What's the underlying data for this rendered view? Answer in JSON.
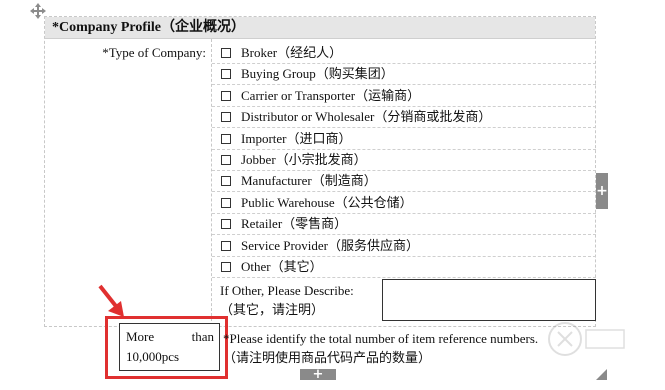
{
  "section": {
    "title": "*Company Profile（企业概况）"
  },
  "type_of_company": {
    "label": "*Type of Company:",
    "options": [
      {
        "label": "Broker（经纪人）",
        "checked": false
      },
      {
        "label": "Buying Group（购买集团）",
        "checked": false
      },
      {
        "label": "Carrier or Transporter（运输商）",
        "checked": false
      },
      {
        "label": "Distributor or Wholesaler（分销商或批发商）",
        "checked": false
      },
      {
        "label": "Importer（进口商）",
        "checked": false
      },
      {
        "label": "Jobber（小宗批发商）",
        "checked": false
      },
      {
        "label": "Manufacturer（制造商）",
        "checked": false
      },
      {
        "label": "Public Warehouse（公共仓储）",
        "checked": false
      },
      {
        "label": "Retailer（零售商）",
        "checked": false
      },
      {
        "label": "Service Provider（服务供应商）",
        "checked": false
      },
      {
        "label": "Other（其它）",
        "checked": false
      }
    ]
  },
  "other_describe": {
    "label_line1": "If Other, Please Describe:",
    "label_line2": "（其它，请注明）",
    "value": ""
  },
  "item_count": {
    "value_word1": "More",
    "value_word2": "than",
    "value_line2": "10,000pcs",
    "note_line1": "*Please identify the total number of item reference numbers.",
    "note_line2": "（请注明使用商品代码产品的数量）"
  },
  "controls": {
    "add_row_symbol": "+",
    "add_col_symbol": "+"
  },
  "colors": {
    "highlight": "#e03030",
    "header_bg": "#e6e6e6",
    "control_bg": "#8a8a8a"
  }
}
